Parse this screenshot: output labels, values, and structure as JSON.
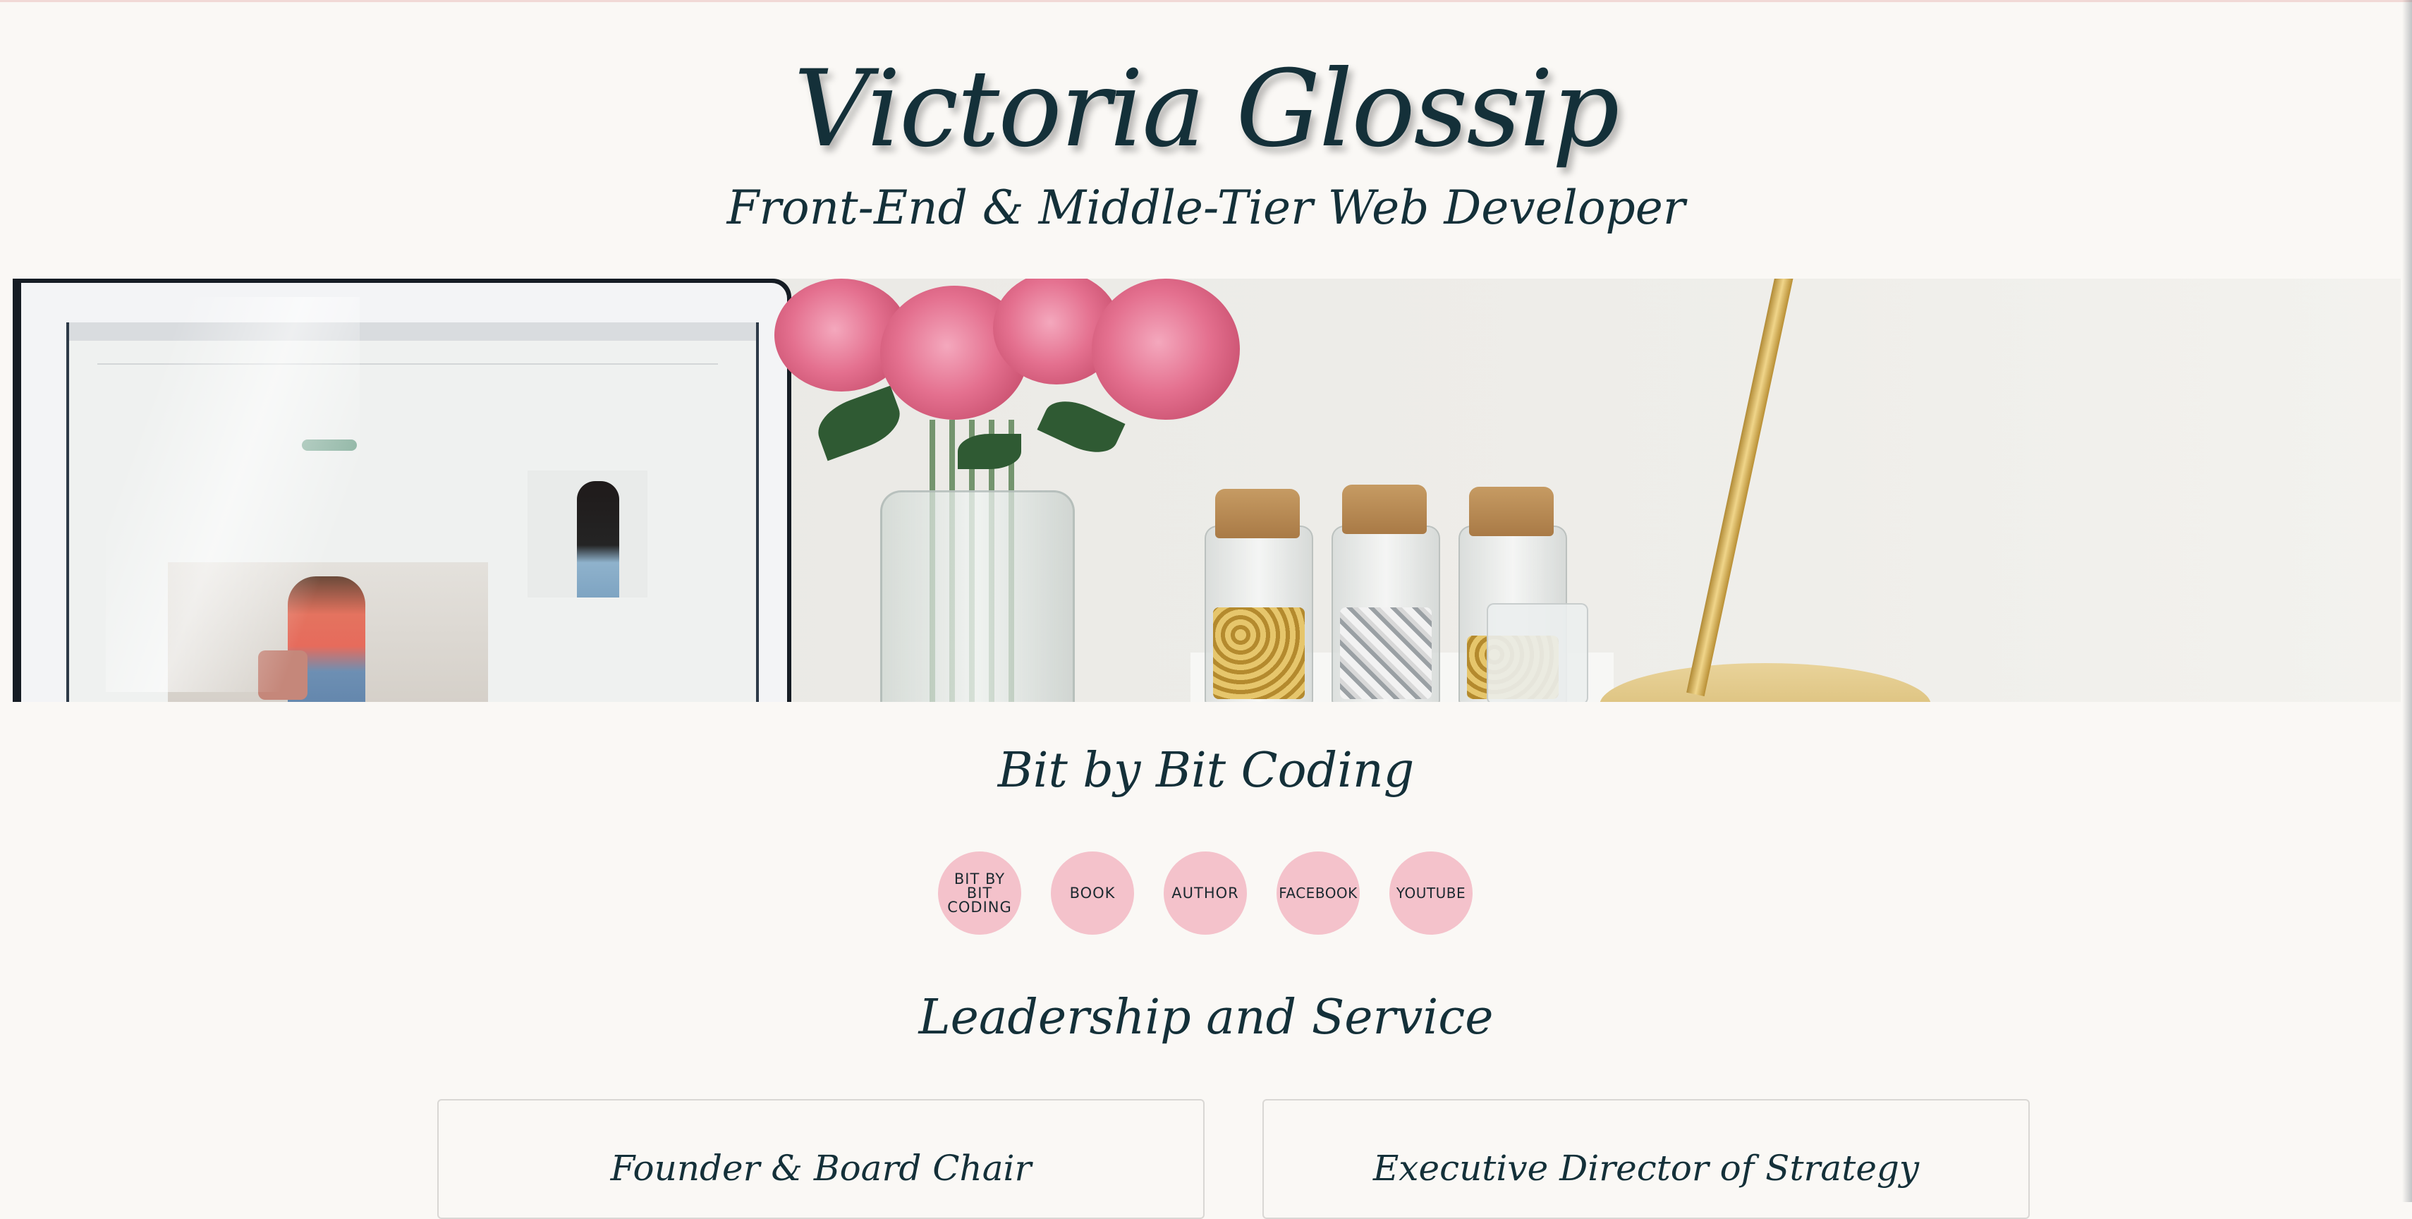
{
  "header": {
    "title": "Victoria Glossip",
    "subtitle": "Front-End & Middle-Tier Web Developer"
  },
  "sections": {
    "bit_by_bit": {
      "heading": "Bit by Bit Coding",
      "links": [
        {
          "label": "BIT BY BIT CODING"
        },
        {
          "label": "BOOK"
        },
        {
          "label": "AUTHOR"
        },
        {
          "label": "FACEBOOK"
        },
        {
          "label": "YOUTUBE"
        }
      ]
    },
    "leadership": {
      "heading": "Leadership and Service",
      "cards": [
        {
          "title": "Founder & Board Chair"
        },
        {
          "title": "Executive Director of Strategy"
        }
      ]
    }
  },
  "colors": {
    "background": "#faf8f5",
    "text": "#143039",
    "circle_button": "#f4c2cb",
    "card_border": "#d9d7d4"
  }
}
